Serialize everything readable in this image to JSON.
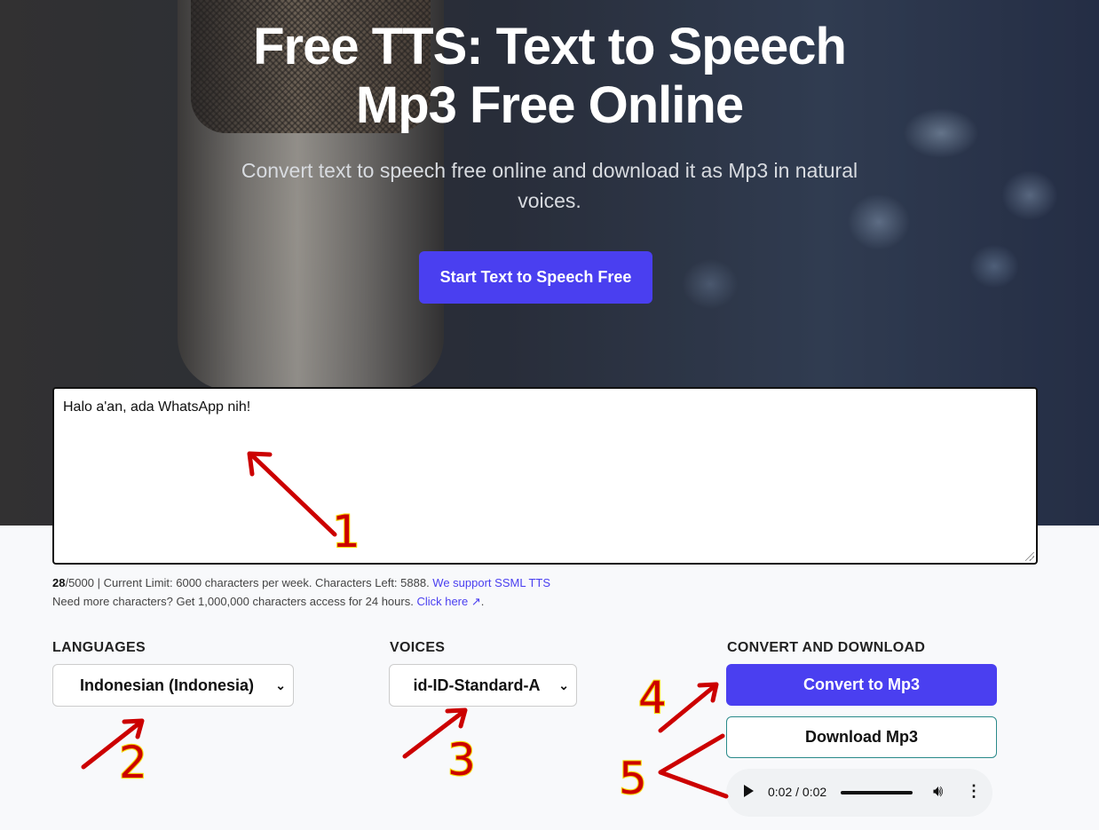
{
  "hero": {
    "title_line1": "Free TTS: Text to Speech",
    "title_line2": "Mp3 Free Online",
    "subtitle": "Convert text to speech free online and download it as Mp3 in natural voices.",
    "cta_label": "Start Text to Speech Free"
  },
  "editor": {
    "value": "Halo a'an, ada WhatsApp nih!"
  },
  "meta": {
    "count": "28",
    "max": "/5000",
    "limit_text": " | Current Limit: 6000 characters per week. Characters Left: 5888. ",
    "ssml_link": "We support SSML TTS",
    "more_text": "Need more characters? Get 1,000,000 characters access for 24 hours. ",
    "click_link": "Click here ↗",
    "period": "."
  },
  "languages": {
    "label": "LANGUAGES",
    "selected": "Indonesian (Indonesia)"
  },
  "voices": {
    "label": "VOICES",
    "selected": "id-ID-Standard-A"
  },
  "convert": {
    "label": "CONVERT AND DOWNLOAD",
    "convert_button": "Convert to Mp3",
    "download_button": "Download Mp3"
  },
  "audio": {
    "time": "0:02 / 0:02",
    "progress": 1.0
  },
  "annotations": [
    "1",
    "2",
    "3",
    "4",
    "5"
  ],
  "colors": {
    "accent": "#4a3ff0",
    "annotation": "#cc0000",
    "annotation_outline": "#f5d800"
  }
}
